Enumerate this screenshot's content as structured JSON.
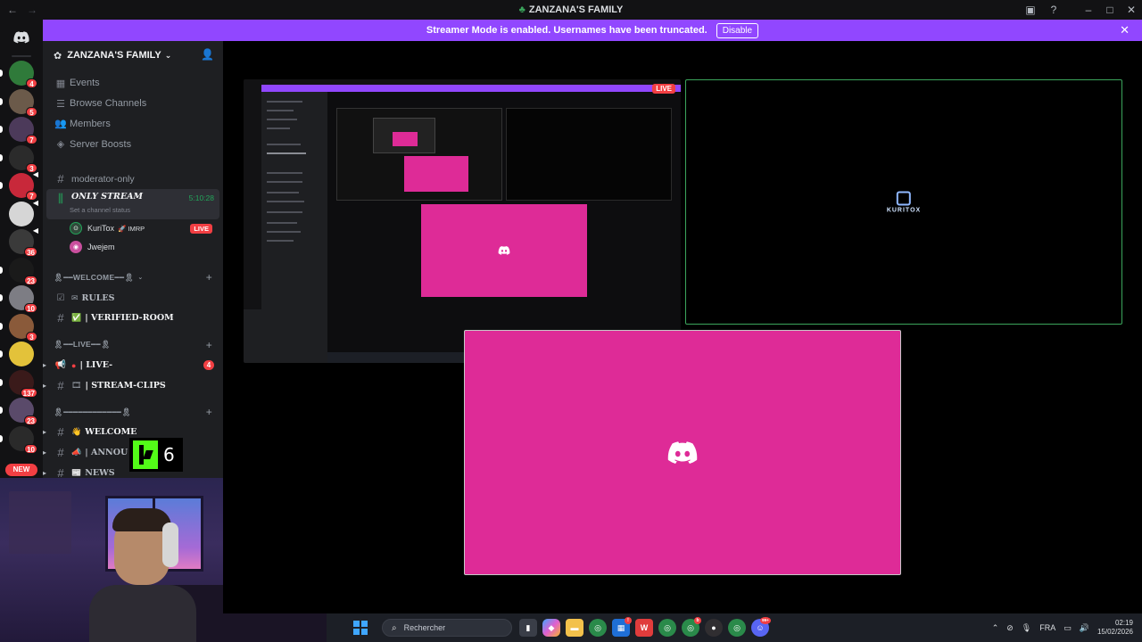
{
  "window": {
    "title": "ZANZANA'S FAMILY"
  },
  "banner": {
    "text": "Streamer Mode is enabled. Usernames have been truncated.",
    "button": "Disable"
  },
  "server": {
    "name": "ZANZANA'S FAMILY"
  },
  "menu": [
    {
      "label": "Events",
      "icon": "calendar-icon"
    },
    {
      "label": "Browse Channels",
      "icon": "browse-icon"
    },
    {
      "label": "Members",
      "icon": "members-icon"
    },
    {
      "label": "Server Boosts",
      "icon": "boost-icon"
    }
  ],
  "channels": {
    "moderator": "moderator-only",
    "active": {
      "name": "ONLY STREAM",
      "status": "Set a channel status",
      "timer": "5:10:28"
    },
    "voice_users": [
      {
        "name": "KuriTox",
        "tag": "🚀 IMRP",
        "live": "LIVE"
      },
      {
        "name": "Jwejem",
        "tag": "",
        "live": ""
      }
    ],
    "welcome_category": "🎗━━WELCOME━━🎗",
    "rules": "RULES",
    "verified": "| VERIFIED-ROOM",
    "live_category": "🎗━━LIVE━━🎗",
    "live_channel": "| LIVE-",
    "live_count": "4",
    "stream_clips": "| STREAM-CLIPS",
    "third_category": "🎗━━━━━━━━━━━━🎗",
    "welcome": "WELCOME",
    "announce": "| ANNOU",
    "news": "NEWS"
  },
  "rail": {
    "badges": [
      "4",
      "5",
      "7",
      "3",
      "7",
      "36",
      "23",
      "10",
      "3",
      "137",
      "23",
      "10"
    ],
    "new_label": "NEW"
  },
  "kick": {
    "count": "6"
  },
  "streams": {
    "tile1_badge": "LIVE",
    "tile2_logo": "KURITOX"
  },
  "taskbar": {
    "search_placeholder": "Rechercher",
    "language": "FRA",
    "time": "02:19",
    "date": "15/02/2026",
    "discord_badge": "99+"
  },
  "colors": {
    "accent": "#9147ff",
    "pink": "#de2b97",
    "live": "#f23f43",
    "green": "#23a55a"
  }
}
